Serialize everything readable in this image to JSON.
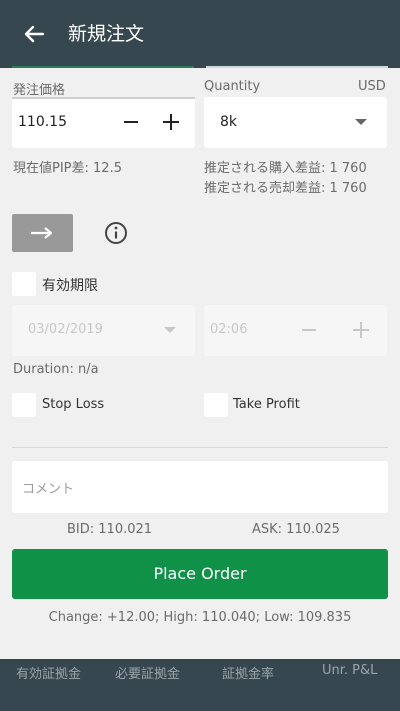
{
  "header": {
    "title": "新規注文"
  },
  "order": {
    "price_label": "発注価格",
    "price_value": "110.15",
    "quantity_label": "Quantity",
    "currency": "USD",
    "quantity_value": "8k",
    "pip_diff": "現在値PIP差: 12.5",
    "est_buy_pl": "推定される購入差益: 1 760",
    "est_sell_pl": "推定される売却差益: 1 760"
  },
  "expiry": {
    "label": "有効期限",
    "date_value": "03/02/2019",
    "time_value": "02:06",
    "duration": "Duration: n/a"
  },
  "options": {
    "stop_loss": "Stop Loss",
    "take_profit": "Take Profit"
  },
  "comment": {
    "placeholder": "コメント"
  },
  "quote": {
    "bid": "BID: 110.021",
    "ask": "ASK: 110.025",
    "stats": "Change: +12.00; High: 110.040; Low: 109.835"
  },
  "actions": {
    "place_order": "Place Order"
  },
  "footer": {
    "items": [
      "有効証拠金",
      "必要証拠金",
      "証拠金率",
      "Unr. P&L"
    ]
  },
  "colors": {
    "header_bg": "#37474f",
    "primary_green": "#0f9147",
    "direction_button_bg": "#999999"
  }
}
